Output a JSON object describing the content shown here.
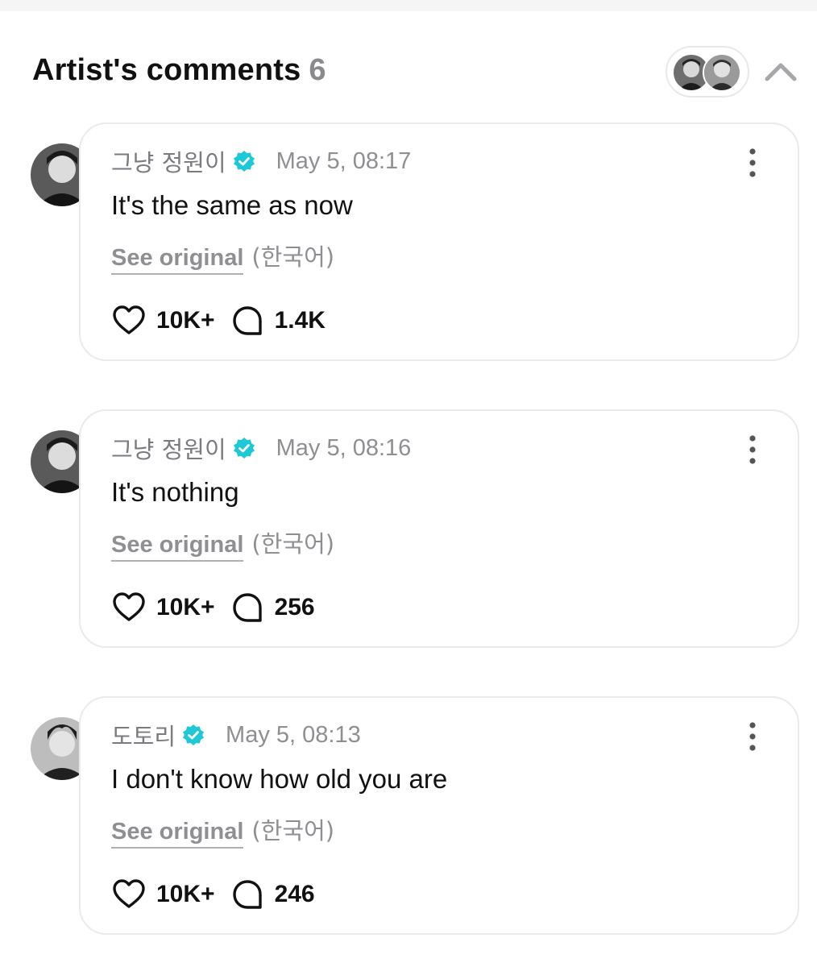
{
  "header": {
    "title": "Artist's comments",
    "count": "6",
    "collapse_icon": "chevron-up-icon"
  },
  "comments": [
    {
      "author": "그냥 정원이",
      "verified": true,
      "time": "May 5, 08:17",
      "text": "It's the same as now",
      "see_original": "See original",
      "language": "(한국어)",
      "likes": "10K+",
      "replies": "1.4K"
    },
    {
      "author": "그냥 정원이",
      "verified": true,
      "time": "May 5, 08:16",
      "text": "It's nothing",
      "see_original": "See original",
      "language": "(한국어)",
      "likes": "10K+",
      "replies": "256"
    },
    {
      "author": "도토리",
      "verified": true,
      "time": "May 5, 08:13",
      "text": "I don't know how old you are",
      "see_original": "See original",
      "language": "(한국어)",
      "likes": "10K+",
      "replies": "246"
    }
  ],
  "colors": {
    "verified_badge": "#1ec8d6",
    "muted_text": "#8e8e93",
    "card_border": "#e9e9ee"
  }
}
